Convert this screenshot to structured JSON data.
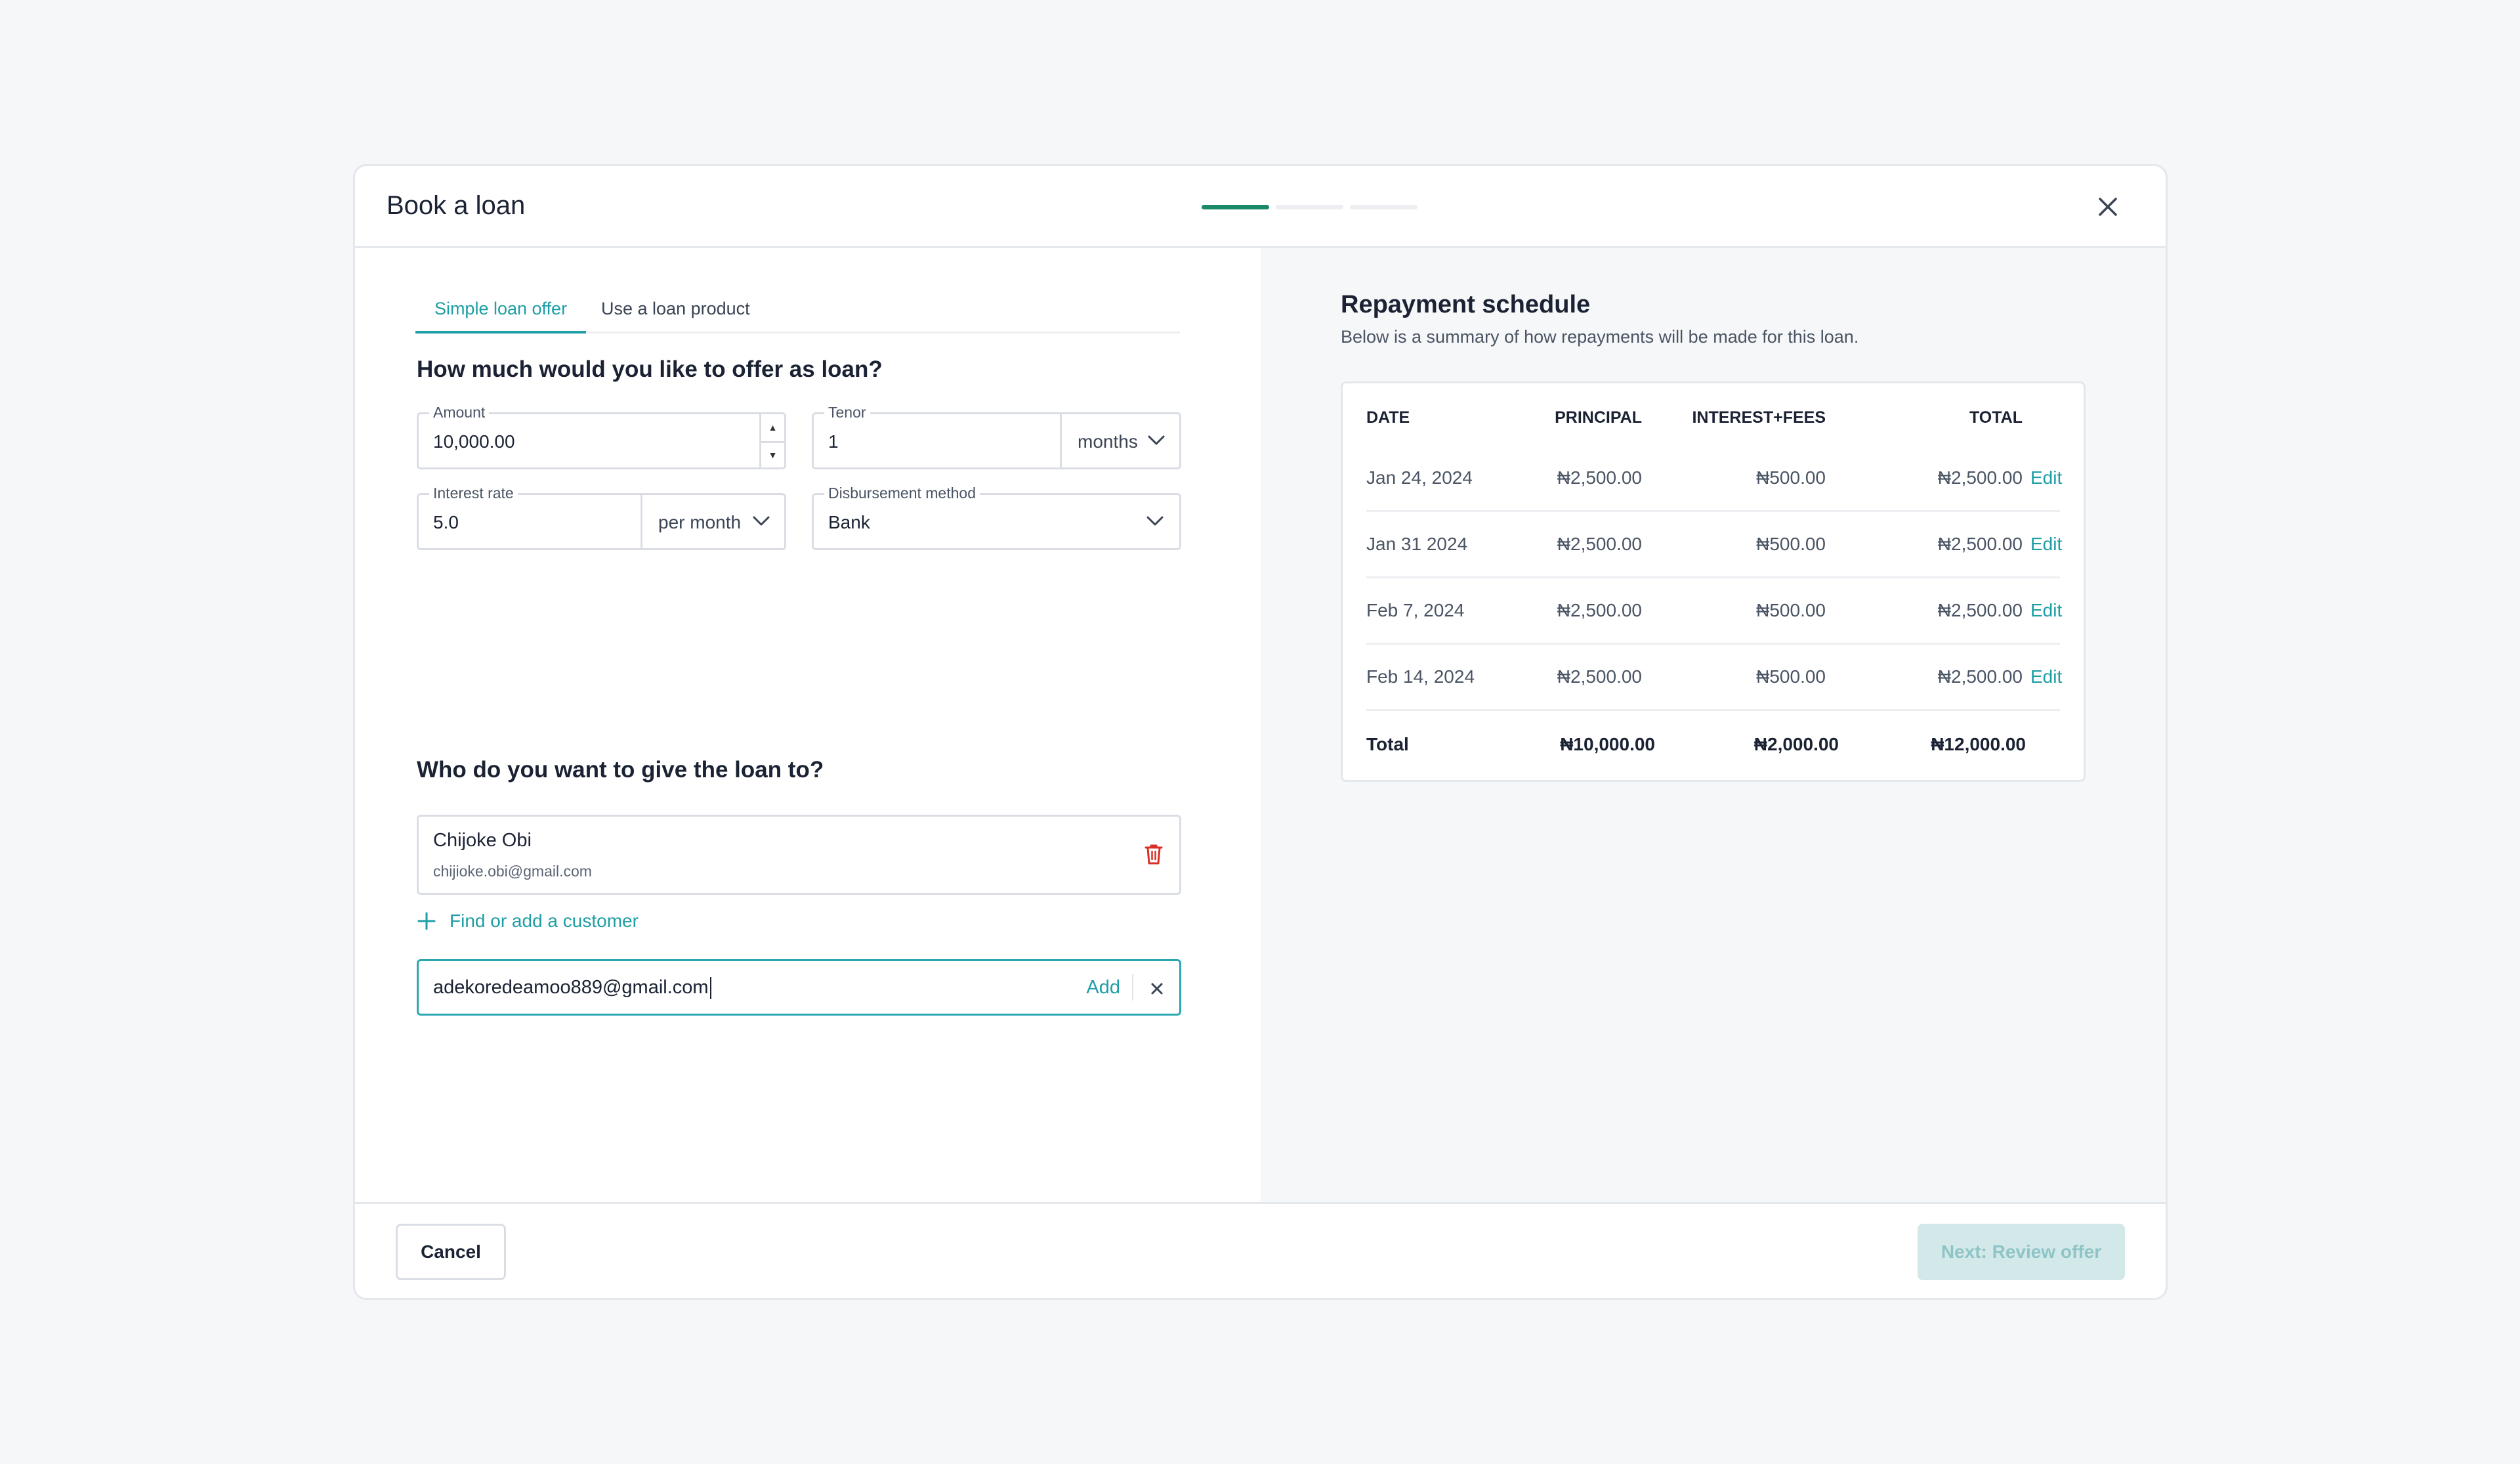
{
  "modal": {
    "title": "Book a loan",
    "steps_total": 3,
    "current_step": 1
  },
  "tabs": [
    {
      "label": "Simple loan offer",
      "active": true
    },
    {
      "label": "Use a loan product",
      "active": false
    }
  ],
  "loan_section": {
    "heading": "How much would you like to offer as loan?",
    "amount": {
      "label": "Amount",
      "value": "10,000.00"
    },
    "tenor": {
      "label": "Tenor",
      "value": "1",
      "unit": "months"
    },
    "interest_rate": {
      "label": "Interest rate",
      "value": "5.0",
      "unit": "per month"
    },
    "disbursement": {
      "label": "Disbursement method",
      "value": "Bank"
    }
  },
  "recipient_section": {
    "heading": "Who do you want to give the loan to?",
    "customer": {
      "name": "Chijoke Obi",
      "email": "chijioke.obi@gmail.com"
    },
    "find_link": "Find or add a customer",
    "email_input": {
      "value": "adekoredeamoo889@gmail.com",
      "add_label": "Add"
    }
  },
  "schedule": {
    "title": "Repayment schedule",
    "subtitle": "Below is a summary of how repayments will be made for this loan.",
    "headers": {
      "date": "DATE",
      "principal": "PRINCIPAL",
      "interest": "INTEREST+FEES",
      "total": "TOTAL"
    },
    "rows": [
      {
        "date": "Jan 24, 2024",
        "principal": "₦2,500.00",
        "interest": "₦500.00",
        "total": "₦2,500.00",
        "edit": "Edit"
      },
      {
        "date": "Jan 31 2024",
        "principal": "₦2,500.00",
        "interest": "₦500.00",
        "total": "₦2,500.00",
        "edit": "Edit"
      },
      {
        "date": "Feb 7, 2024",
        "principal": "₦2,500.00",
        "interest": "₦500.00",
        "total": "₦2,500.00",
        "edit": "Edit"
      },
      {
        "date": "Feb 14, 2024",
        "principal": "₦2,500.00",
        "interest": "₦500.00",
        "total": "₦2,500.00",
        "edit": "Edit"
      }
    ],
    "totals": {
      "label": "Total",
      "principal": "₦10,000.00",
      "interest": "₦2,000.00",
      "total": "₦12,000.00"
    }
  },
  "footer": {
    "cancel_label": "Cancel",
    "next_label": "Next: Review offer"
  },
  "colors": {
    "accent": "#1e9ea5",
    "progress_active": "#1a8a6a",
    "danger": "#d93025",
    "next_disabled_bg": "#d3e9e9"
  }
}
